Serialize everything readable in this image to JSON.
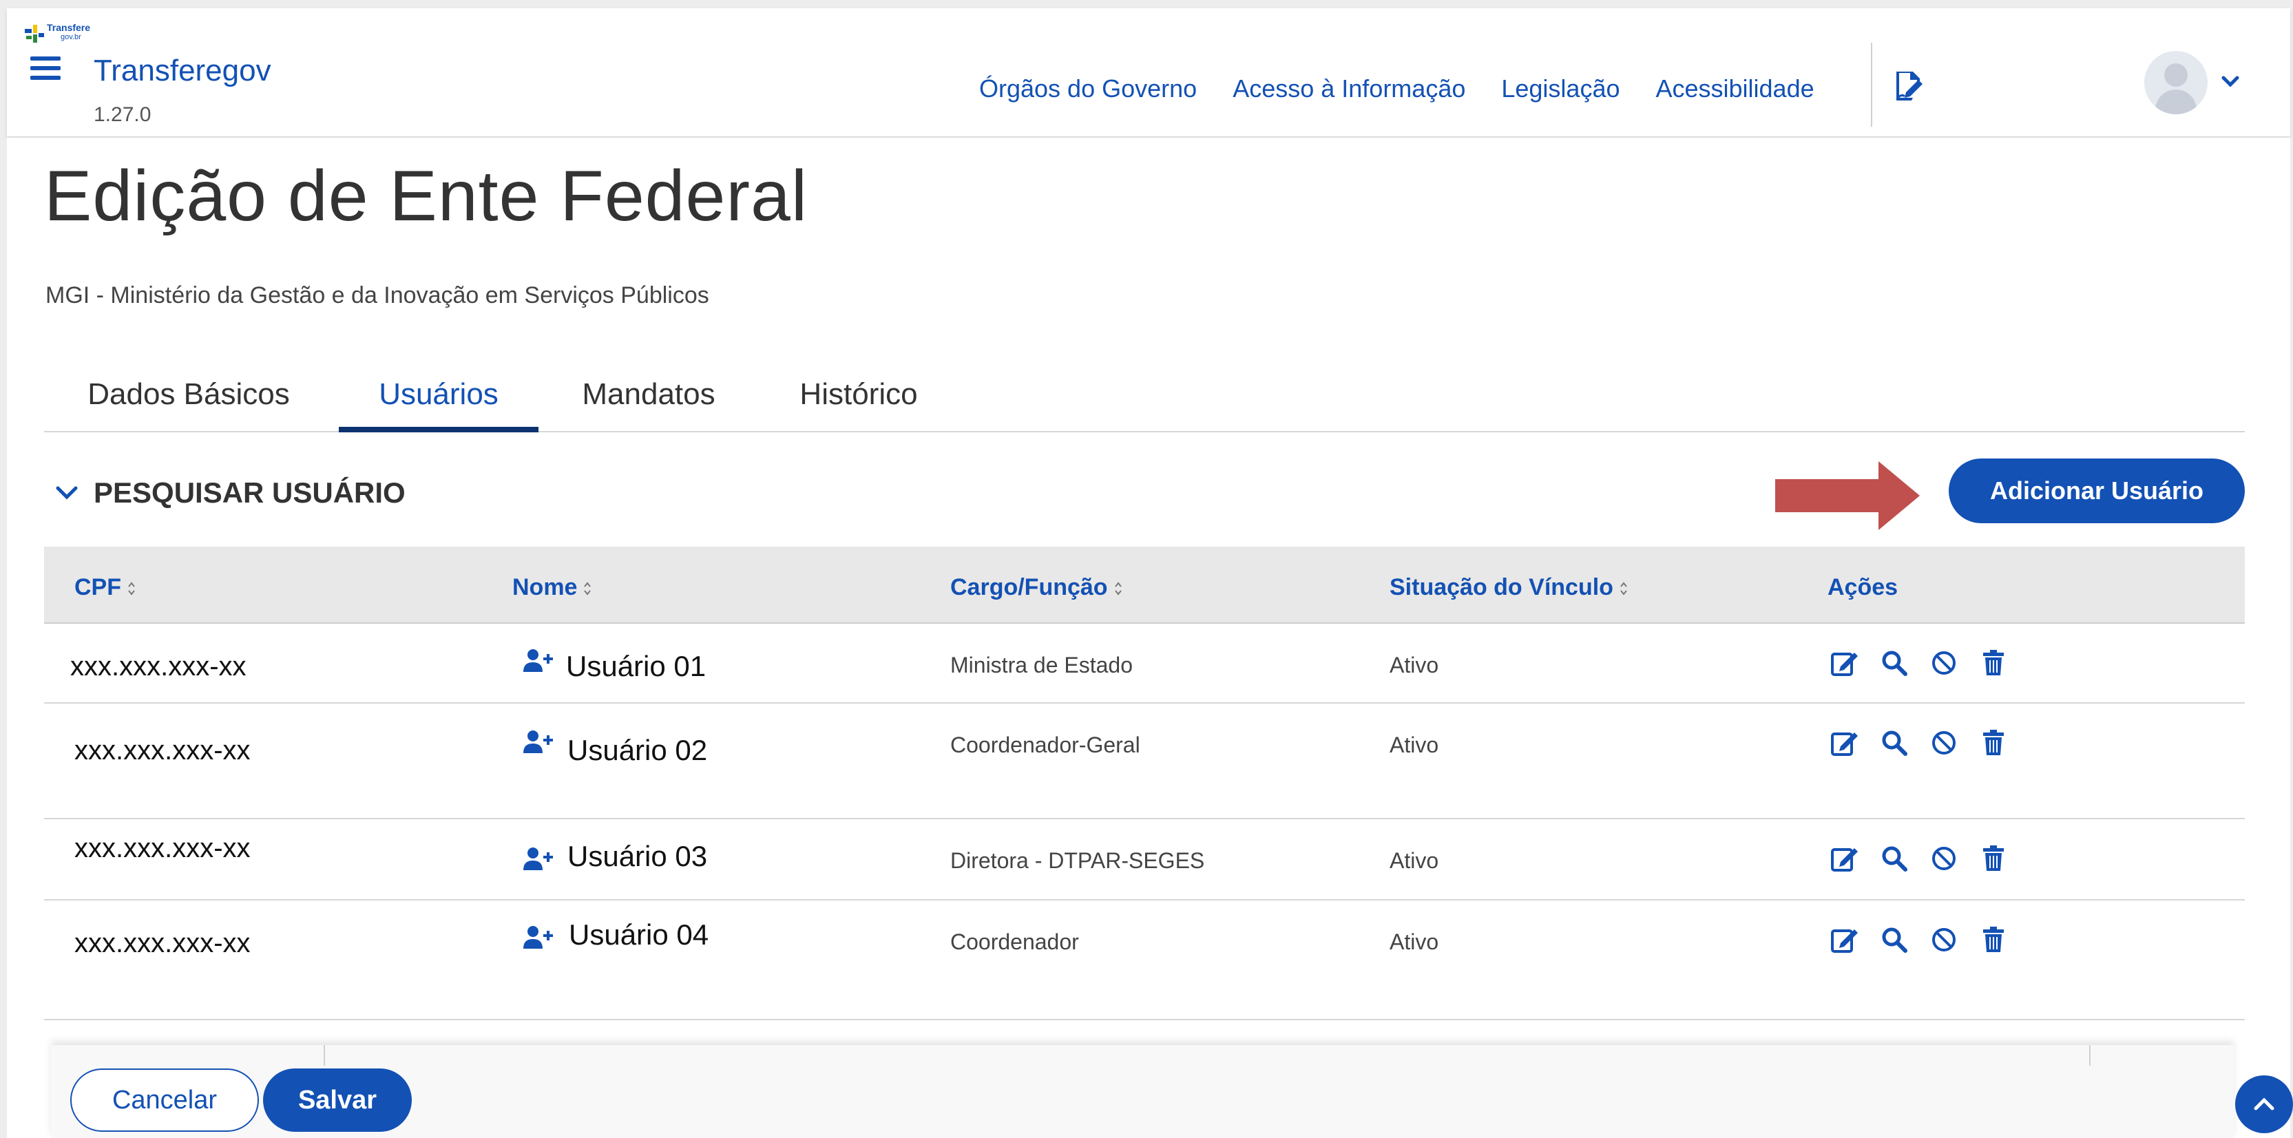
{
  "header": {
    "logo_line1": "Transfere",
    "logo_line2": "gov.br",
    "app_title": "Transferegov",
    "version": "1.27.0",
    "nav_links": [
      {
        "label": "Órgãos do Governo"
      },
      {
        "label": "Acesso à Informação"
      },
      {
        "label": "Legislação"
      },
      {
        "label": "Acessibilidade"
      }
    ]
  },
  "page": {
    "title": "Edição de Ente Federal",
    "subtitle": "MGI - Ministério da Gestão e da Inovação em Serviços Públicos"
  },
  "tabs": [
    {
      "label": "Dados Básicos",
      "active": false
    },
    {
      "label": "Usuários",
      "active": true
    },
    {
      "label": "Mandatos",
      "active": false
    },
    {
      "label": "Histórico",
      "active": false
    }
  ],
  "search": {
    "toggle_label": "PESQUISAR USUÁRIO"
  },
  "add_user_button": "Adicionar Usuário",
  "table": {
    "headers": {
      "cpf": "CPF",
      "nome": "Nome",
      "cargo": "Cargo/Função",
      "situacao": "Situação do Vínculo",
      "acoes": "Ações"
    },
    "rows": [
      {
        "cpf": "xxx.xxx.xxx-xx",
        "nome": "Usuário 01",
        "cargo": "Ministra de Estado",
        "situacao": "Ativo"
      },
      {
        "cpf": "xxx.xxx.xxx-xx",
        "nome": "Usuário 02",
        "cargo": "Coordenador-Geral",
        "situacao": "Ativo"
      },
      {
        "cpf": "xxx.xxx.xxx-xx",
        "nome": "Usuário 03",
        "cargo": "Diretora - DTPAR-SEGES",
        "situacao": "Ativo"
      },
      {
        "cpf": "xxx.xxx.xxx-xx",
        "nome": "Usuário 04",
        "cargo": "Coordenador",
        "situacao": "Ativo"
      }
    ]
  },
  "footer": {
    "cancel_label": "Cancelar",
    "save_label": "Salvar"
  },
  "colors": {
    "primary": "#1351b4",
    "primary_dark": "#0c326f",
    "arrow": "#c0504d"
  }
}
